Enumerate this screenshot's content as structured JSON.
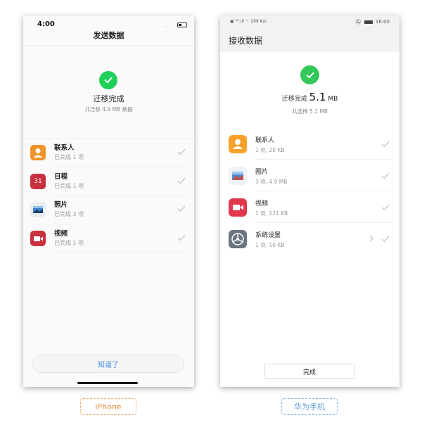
{
  "iphone": {
    "status": {
      "time": "4:00",
      "signal": "....",
      "battery": "battery-icon"
    },
    "title": "发送数据",
    "result_title": "迁移完成",
    "result_sub": "共迁移 4.9 MB 数据",
    "items": [
      {
        "name": "联系人",
        "status": "已完成 1 项",
        "icon": "contacts-icon",
        "icon_color": "#f0932b"
      },
      {
        "name": "日程",
        "status": "已完成 1 项",
        "icon": "calendar-icon",
        "icon_text": "31",
        "icon_color": "#c8303e"
      },
      {
        "name": "照片",
        "status": "已完成 3 项",
        "icon": "photos-icon",
        "icon_color": "#e9eef3"
      },
      {
        "name": "视频",
        "status": "已完成 1 项",
        "icon": "video-icon",
        "icon_color": "#c8303e"
      }
    ],
    "button_label": "知道了"
  },
  "huawei": {
    "status": {
      "left": "▣ ⁴ᴳ.ıll ⌔ 299 K/s",
      "time": "16:00"
    },
    "title": "接收数据",
    "result_prefix": "迁移完成",
    "result_size": "5.1",
    "result_unit": "MB",
    "result_sub": "共选择 5.1 MB",
    "items": [
      {
        "name": "联系人",
        "meta": "1 项, 20 KB",
        "icon": "contacts-icon",
        "icon_color": "#f7a12a"
      },
      {
        "name": "图片",
        "meta": "3 项, 4.9 MB",
        "icon": "gallery-icon",
        "icon_color": "#eef3f8"
      },
      {
        "name": "视频",
        "meta": "1 项, 221 KB",
        "icon": "video-icon",
        "icon_color": "#e0384a"
      },
      {
        "name": "系统设置",
        "meta": "1 项, 10 KB",
        "icon": "settings-icon",
        "icon_color": "#6b7480"
      }
    ],
    "button_label": "完成"
  },
  "captions": {
    "iphone": "iPhone",
    "huawei": "华为手机"
  },
  "colors": {
    "success": "#22c55e",
    "ios_link": "#3b8de8"
  }
}
